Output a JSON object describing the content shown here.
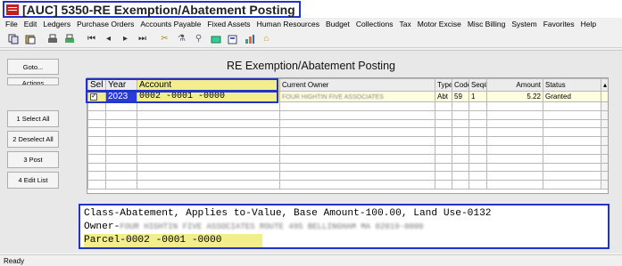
{
  "window": {
    "title": "[AUC] 5350-RE Exemption/Abatement Posting"
  },
  "menu": {
    "left": [
      "File",
      "Edit",
      "Ledgers",
      "Purchase Orders",
      "Accounts Payable",
      "Fixed Assets"
    ],
    "right": [
      "Human Resources",
      "Budget",
      "Collections",
      "Tax",
      "Motor Excise",
      "Misc Billing",
      "System",
      "Favorites",
      "Help"
    ]
  },
  "toolbar": {
    "icons": [
      "copy-icon",
      "paste-icon",
      "print-icon",
      "print-preview-icon",
      "first-record-icon",
      "previous-record-icon",
      "next-record-icon",
      "last-record-icon",
      "tools-icon",
      "filter-icon",
      "search-icon",
      "email-icon",
      "export-icon",
      "chart-icon",
      "home-icon"
    ]
  },
  "form": {
    "title": "RE Exemption/Abatement Posting"
  },
  "side_buttons": {
    "goto": "Goto...",
    "actions": "Actions",
    "select_all": "1 Select All",
    "deselect_all": "2 Deselect All",
    "post": "3 Post",
    "edit_list": "4 Edit List"
  },
  "grid": {
    "columns": {
      "sel": "Sel",
      "year": "Year",
      "account": "Account",
      "owner": "Current Owner",
      "type": "Type",
      "code": "Code",
      "seq": "Seq#",
      "amount": "Amount",
      "status": "Status"
    },
    "row": {
      "year": "2023",
      "account": "0002     -0001     -0000",
      "owner": "FOUR HIGHTIN FIVE ASSOCIATES",
      "type": "Abt",
      "code": "59",
      "seq": "1",
      "amount": "5.22",
      "status": "Granted"
    }
  },
  "info": {
    "line1": "Class-Abatement, Applies to-Value, Base Amount-100.00, Land Use-0132",
    "owner_label": "Owner-",
    "owner_value": "FOUR HIGHTIN FIVE ASSOCIATES ROUTE 495 BELLINGHAM MA 02019-0000",
    "parcel": "Parcel-0002     -0001     -0000"
  },
  "status_bar": {
    "text": "Ready"
  },
  "colors": {
    "highlight_border": "#2233cc",
    "highlight_yellow": "#f3ee8c",
    "selected_year_bg": "#2a3bd8"
  }
}
